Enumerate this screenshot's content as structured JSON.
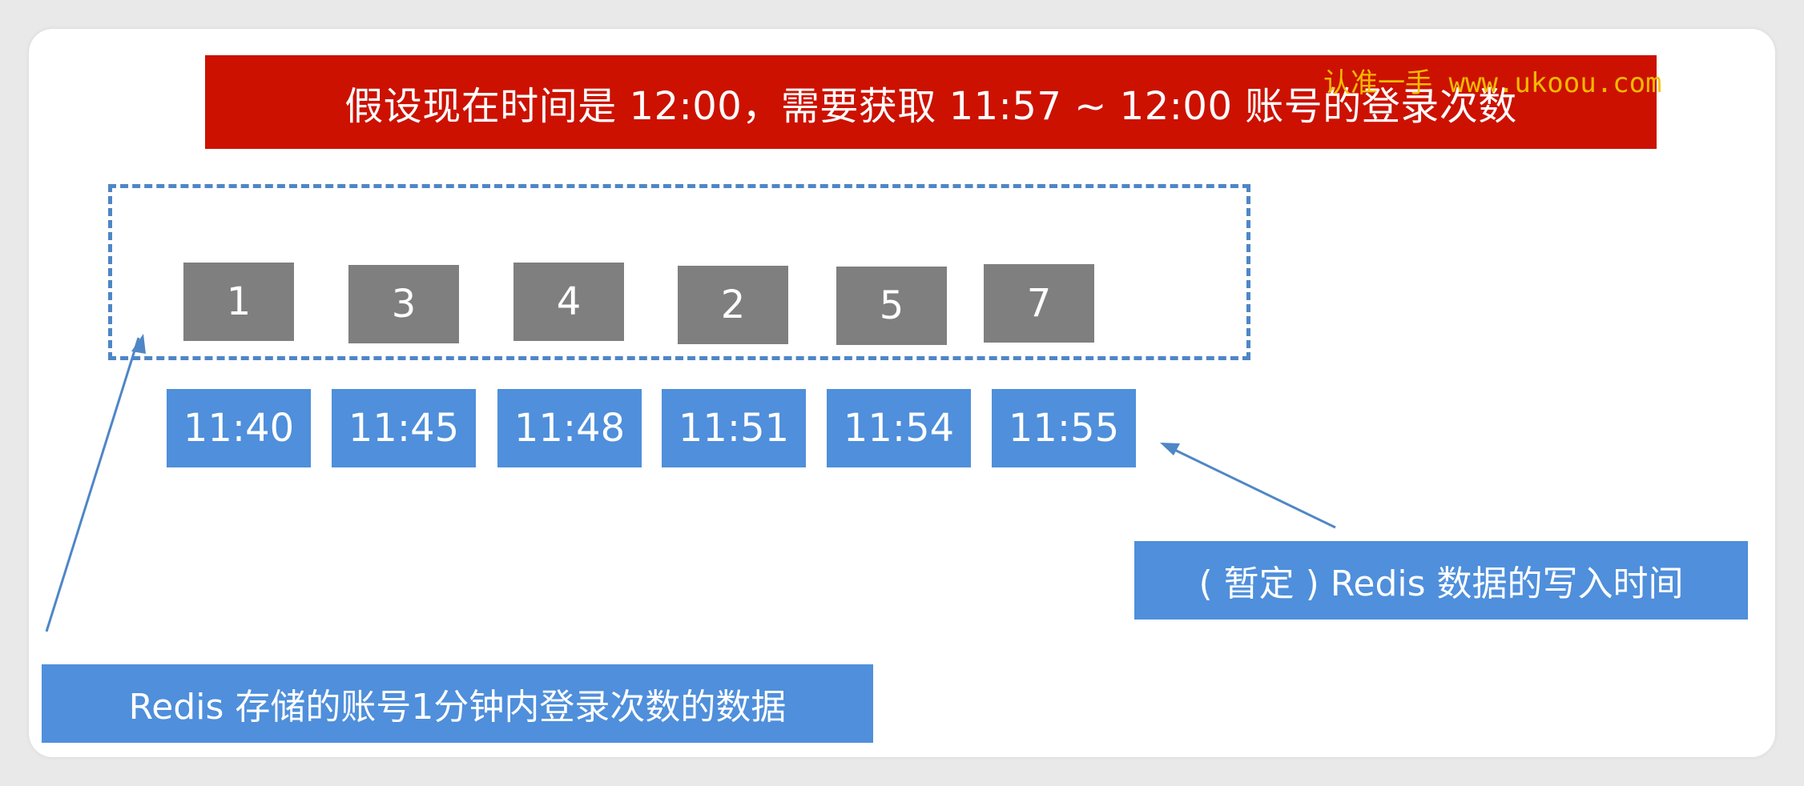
{
  "title": "假设现在时间是 12:00，需要获取 11:57 ~ 12:00 账号的登录次数",
  "watermark": "认准一手 www.ukoou.com",
  "counts": [
    "1",
    "3",
    "4",
    "2",
    "5",
    "7"
  ],
  "times": [
    "11:40",
    "11:45",
    "11:48",
    "11:51",
    "11:54",
    "11:55"
  ],
  "labels": {
    "write_time": "( 暂定 ) Redis 数据的写入时间",
    "storage": "Redis 存储的账号1分钟内登录次数的数据"
  },
  "colors": {
    "title_bg": "#cc1100",
    "count_bg": "#7f7f7f",
    "time_bg": "#4f8fdb",
    "dash": "#4f86c6",
    "watermark": "#f5c400"
  }
}
